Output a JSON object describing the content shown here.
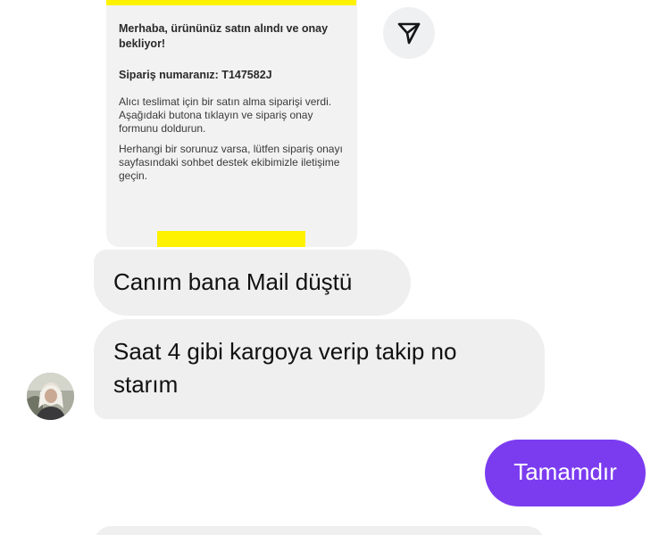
{
  "shared_email": {
    "greeting": "Merhaba, ürününüz satın alındı ve onay bekliyor!",
    "order_label": "Sipariş numaranız: T147582J",
    "paragraph_1": "Alıcı teslimat için bir satın alma siparişi verdi. Aşağıdaki butona tıklayın ve sipariş onay formunu doldurun.",
    "paragraph_2": "Herhangi bir sorunuz varsa, lütfen sipariş onayı sayfasındaki sohbet destek ekibimizle iletişime geçin.",
    "accent_color": "#fff200"
  },
  "share_button": {
    "icon": "send-icon"
  },
  "messages": [
    {
      "direction": "incoming",
      "text": "Canım bana Mail düştü"
    },
    {
      "direction": "incoming",
      "text": "Saat 4 gibi kargoya verip takip no starım"
    },
    {
      "direction": "outgoing",
      "text": "Tamamdır"
    }
  ],
  "avatar": {
    "icon": "user-avatar"
  },
  "colors": {
    "incoming_bubble": "#efeff0",
    "outgoing_bubble": "#7b3cf0",
    "outgoing_text": "#ffffff"
  }
}
